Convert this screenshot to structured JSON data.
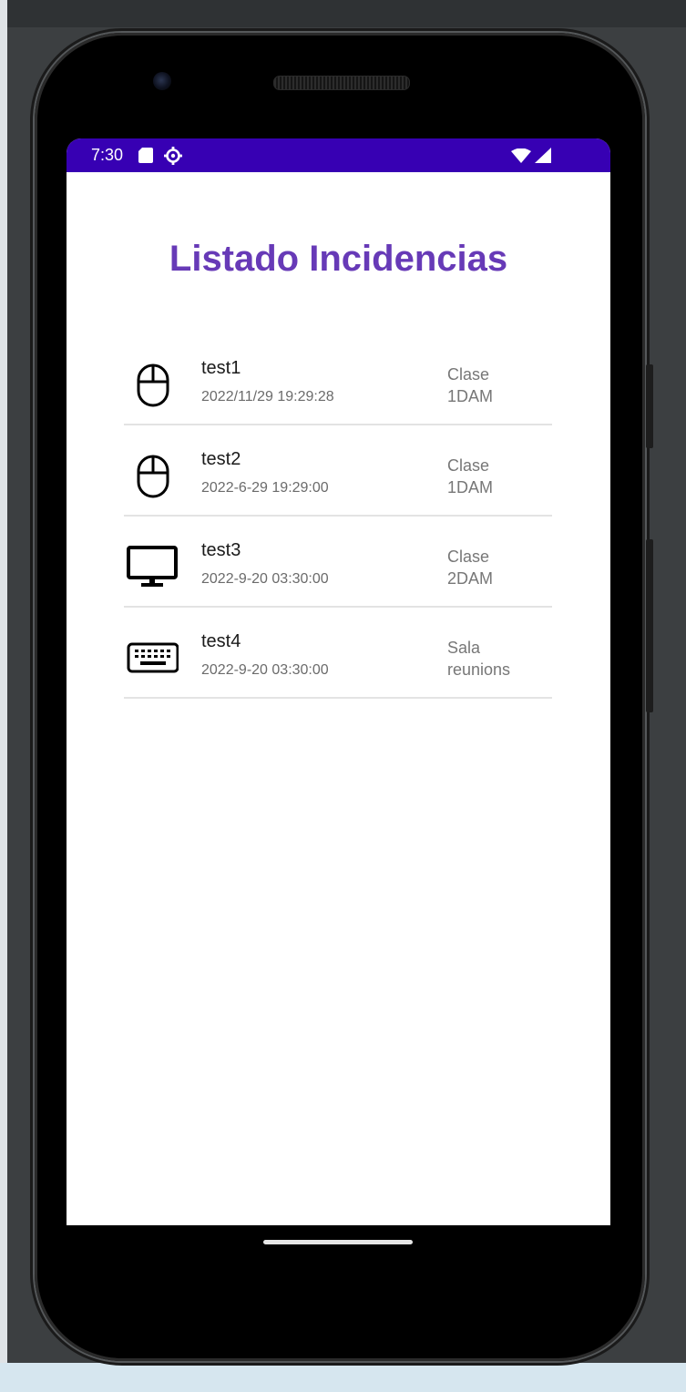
{
  "status_bar": {
    "time": "7:30",
    "background": "#3700b3"
  },
  "title": "Listado Incidencias",
  "title_color": "#673ab7",
  "incidents": [
    {
      "icon": "mouse-icon",
      "name": "test1",
      "date": "2022/11/29 19:29:28",
      "location_line1": "Clase",
      "location_line2": "1DAM"
    },
    {
      "icon": "mouse-icon",
      "name": "test2",
      "date": "2022-6-29 19:29:00",
      "location_line1": "Clase",
      "location_line2": "1DAM"
    },
    {
      "icon": "monitor-icon",
      "name": "test3",
      "date": "2022-9-20 03:30:00",
      "location_line1": "Clase",
      "location_line2": "2DAM"
    },
    {
      "icon": "keyboard-icon",
      "name": "test4",
      "date": "2022-9-20 03:30:00",
      "location_line1": "Sala",
      "location_line2": "reunions"
    }
  ]
}
